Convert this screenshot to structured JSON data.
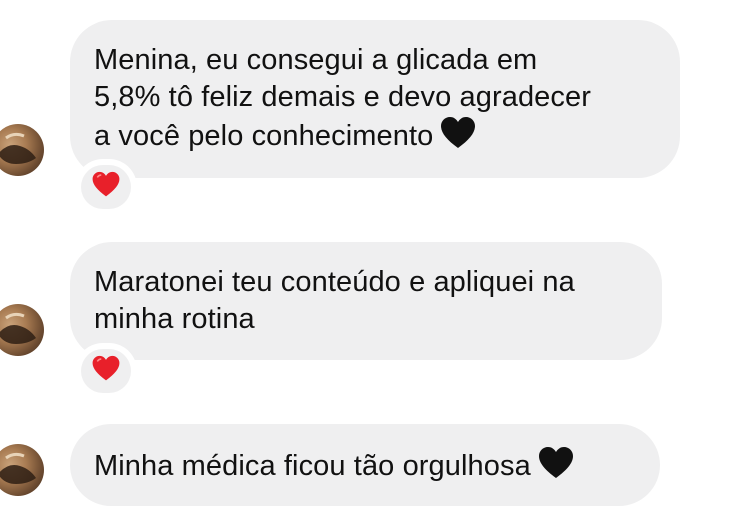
{
  "messages": [
    {
      "lines": [
        "Menina, eu consegui a glicada em",
        "5,8% tô feliz demais e devo agradecer",
        "a você pelo conhecimento"
      ],
      "trailing_emoji": "black-heart",
      "reaction": "red-heart"
    },
    {
      "lines": [
        "Maratonei teu conteúdo e apliquei na",
        "minha rotina"
      ],
      "trailing_emoji": "",
      "reaction": "red-heart"
    },
    {
      "lines": [
        "Minha médica ficou tão orgulhosa"
      ],
      "trailing_emoji": "black-heart",
      "reaction": ""
    }
  ],
  "colors": {
    "bubble_bg": "#efeff0",
    "text": "#111111",
    "reaction_heart": "#e8202a",
    "black_heart": "#111111"
  }
}
